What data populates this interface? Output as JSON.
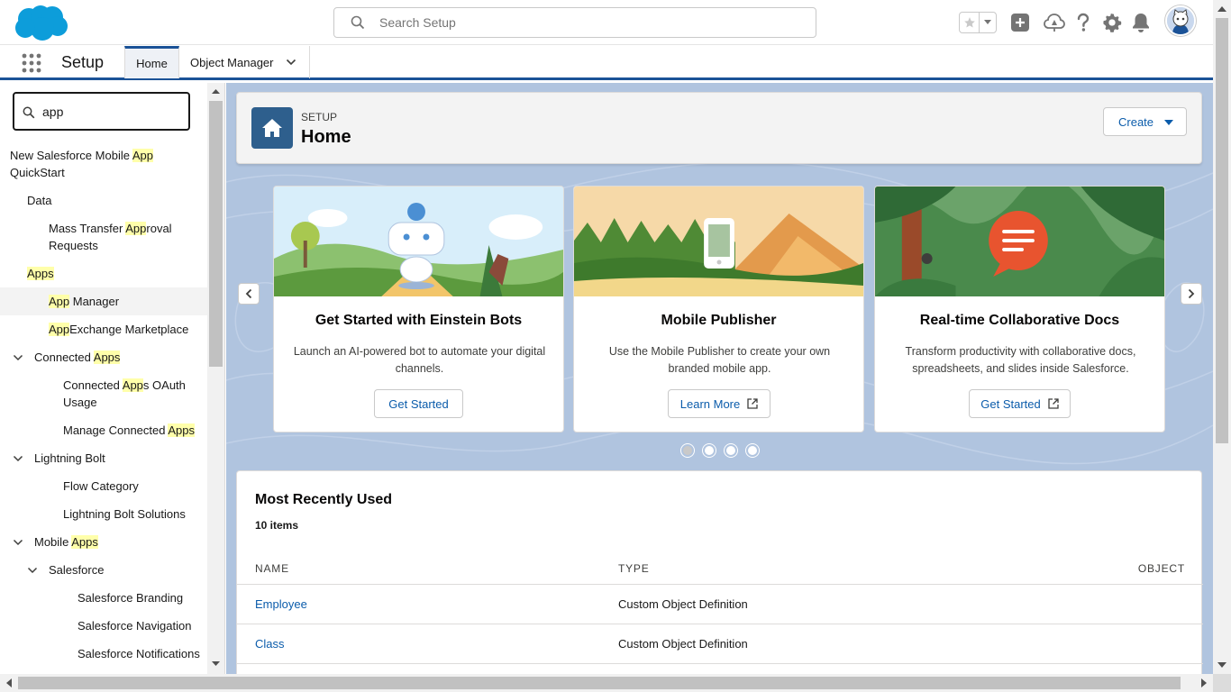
{
  "header": {
    "search_placeholder": "Search Setup",
    "icons": [
      "favorites-star-icon",
      "add-icon",
      "trailhead-icon",
      "help-icon",
      "settings-gear-icon",
      "notifications-bell-icon",
      "avatar"
    ]
  },
  "nav": {
    "app_name": "Setup",
    "tabs": [
      {
        "label": "Home",
        "active": true
      },
      {
        "label": "Object Manager",
        "active": false
      }
    ]
  },
  "sidebar": {
    "quickfind_value": "app",
    "items": [
      {
        "pre": "New Salesforce Mobile ",
        "hl": "App",
        "post": "",
        "line2": "QuickStart",
        "indent": 0,
        "toggle": false
      },
      {
        "pre": "Data",
        "hl": "",
        "post": "",
        "indent": 0,
        "toggle": true
      },
      {
        "pre": "Mass Transfer ",
        "hl": "App",
        "post": "roval",
        "line2": "Requests",
        "indent": 2,
        "toggle": false
      },
      {
        "pre": "",
        "hl": "Apps",
        "post": "",
        "indent": 0,
        "toggle": true
      },
      {
        "pre": "",
        "hl": "App",
        "post": " Manager",
        "indent": 2,
        "toggle": false,
        "selected": true
      },
      {
        "pre": "",
        "hl": "App",
        "post": "Exchange Marketplace",
        "indent": 2,
        "toggle": false
      },
      {
        "pre": "Connected ",
        "hl": "Apps",
        "post": "",
        "indent": 1,
        "toggle": true
      },
      {
        "pre": "Connected ",
        "hl": "App",
        "post": "s OAuth",
        "line2": "Usage",
        "indent": 3,
        "toggle": false
      },
      {
        "pre": "Manage Connected ",
        "hl": "Apps",
        "post": "",
        "indent": 3,
        "toggle": false
      },
      {
        "pre": "Lightning Bolt",
        "hl": "",
        "post": "",
        "indent": 1,
        "toggle": true
      },
      {
        "pre": "Flow Category",
        "hl": "",
        "post": "",
        "indent": 3,
        "toggle": false
      },
      {
        "pre": "Lightning Bolt Solutions",
        "hl": "",
        "post": "",
        "indent": 3,
        "toggle": false
      },
      {
        "pre": "Mobile ",
        "hl": "Apps",
        "post": "",
        "indent": 1,
        "toggle": true
      },
      {
        "pre": "Salesforce",
        "hl": "",
        "post": "",
        "indent": 2,
        "toggle": true,
        "sub": true
      },
      {
        "pre": "Salesforce Branding",
        "hl": "",
        "post": "",
        "indent": 4,
        "toggle": false
      },
      {
        "pre": "Salesforce Navigation",
        "hl": "",
        "post": "",
        "indent": 4,
        "toggle": false
      },
      {
        "pre": "Salesforce Notifications",
        "hl": "",
        "post": "",
        "indent": 4,
        "toggle": false
      }
    ]
  },
  "page_header": {
    "eyebrow": "SETUP",
    "title": "Home",
    "create_label": "Create"
  },
  "cards": [
    {
      "title": "Get Started with Einstein Bots",
      "desc": "Launch an AI-powered bot to automate your digital channels.",
      "button": "Get Started",
      "external": false
    },
    {
      "title": "Mobile Publisher",
      "desc": "Use the Mobile Publisher to create your own branded mobile app.",
      "button": "Learn More",
      "external": true
    },
    {
      "title": "Real-time Collaborative Docs",
      "desc": "Transform productivity with collaborative docs, spreadsheets, and slides inside Salesforce.",
      "button": "Get Started",
      "external": true
    }
  ],
  "carousel": {
    "active_dot": 0,
    "dot_count": 4
  },
  "mru": {
    "title": "Most Recently Used",
    "count": "10 items",
    "columns": [
      "NAME",
      "TYPE",
      "OBJECT"
    ],
    "rows": [
      {
        "name": "Employee",
        "type": "Custom Object Definition",
        "object": ""
      },
      {
        "name": "Class",
        "type": "Custom Object Definition",
        "object": ""
      }
    ]
  },
  "colors": {
    "brand_blue": "#0176d3",
    "nav_accent": "#1b5297",
    "link": "#0b5cab",
    "highlight": "#ffffaa",
    "main_bg": "#b0c4df"
  }
}
